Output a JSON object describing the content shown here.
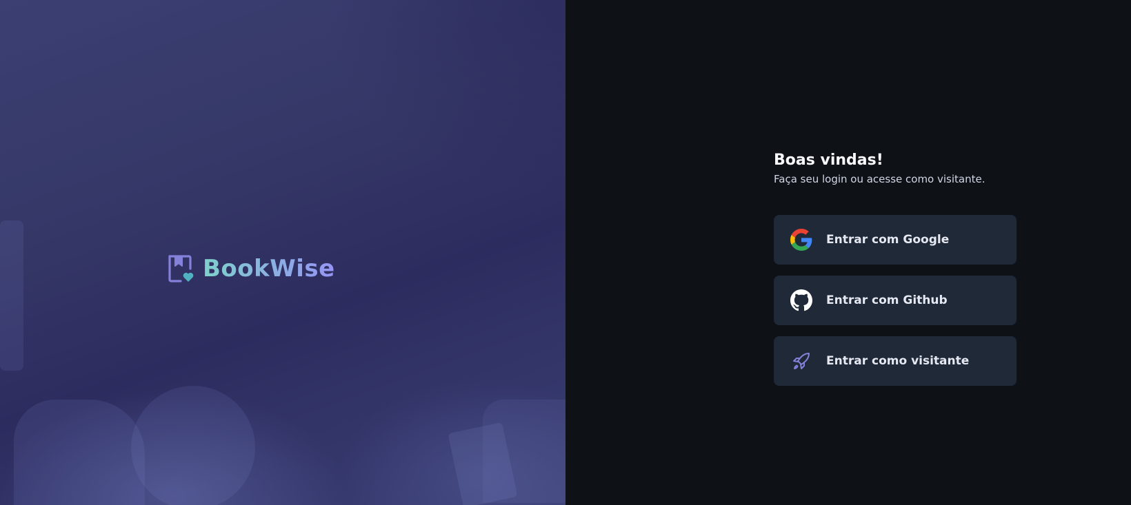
{
  "brand": {
    "name": "BookWise",
    "colors": {
      "teal": "#50b2c0",
      "purple": "#8381d9"
    }
  },
  "login": {
    "title": "Boas vindas!",
    "subtitle": "Faça seu login ou acesse como visitante.",
    "buttons": [
      {
        "label": "Entrar com Google",
        "icon": "google-icon"
      },
      {
        "label": "Entrar com Github",
        "icon": "github-icon"
      },
      {
        "label": "Entrar como visitante",
        "icon": "rocket-icon"
      }
    ]
  },
  "colors": {
    "background": "#0e1116",
    "button_bg": "#1f2937",
    "text_primary": "#f8f9fc",
    "text_secondary": "#d1d6e4"
  }
}
